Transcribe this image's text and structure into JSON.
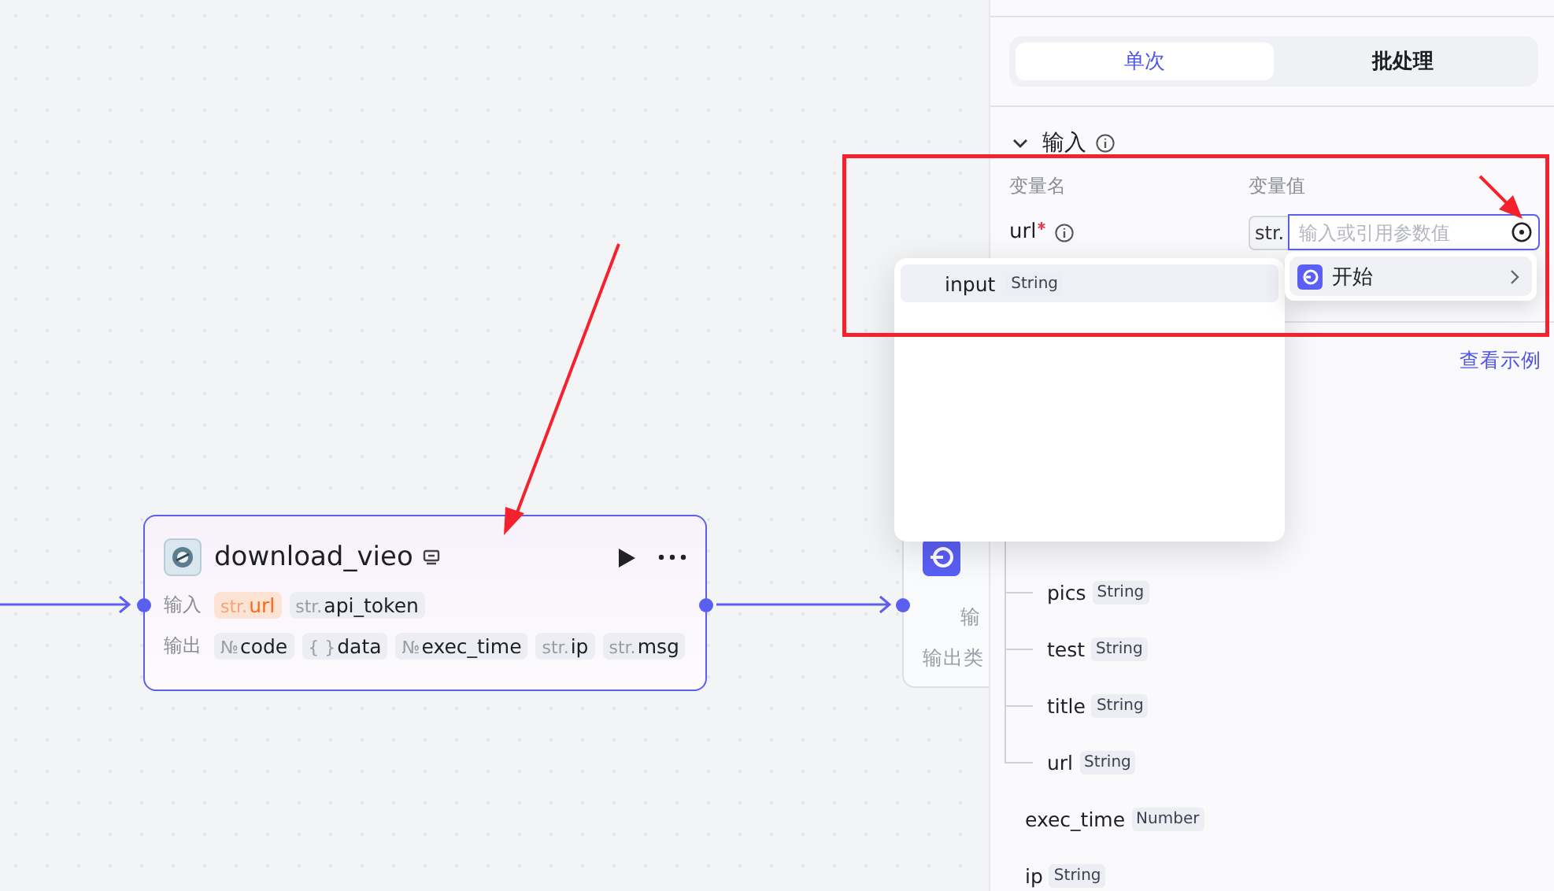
{
  "canvas": {
    "nodes": [
      {
        "title": "download_vieo",
        "selected": true,
        "inputs_label": "输入",
        "outputs_label": "输出",
        "inputs": [
          {
            "type": "str.",
            "name": "url",
            "highlighted": true
          },
          {
            "type": "str.",
            "name": "api_token",
            "highlighted": false
          }
        ],
        "outputs": [
          {
            "type": "№",
            "name": "code"
          },
          {
            "type": "{ }",
            "name": "data"
          },
          {
            "type": "№",
            "name": "exec_time"
          },
          {
            "type": "str.",
            "name": "ip"
          },
          {
            "type": "str.",
            "name": "msg"
          }
        ]
      }
    ],
    "partial_node": {
      "lines": [
        "输",
        "输出类"
      ]
    }
  },
  "panel": {
    "tabs": [
      {
        "label": "单次",
        "selected": true
      },
      {
        "label": "批处理",
        "selected": false
      }
    ],
    "input_section": {
      "title": "输入",
      "expanded": true,
      "columns": [
        "变量名",
        "变量值"
      ],
      "rows": [
        {
          "name": "url",
          "required": true,
          "type": "str.",
          "placeholder": "输入或引用参数值"
        }
      ]
    },
    "example_link": "查看示例",
    "output_tree": [
      {
        "children": [
          {
            "name": "pics",
            "type": "String"
          },
          {
            "name": "test",
            "type": "String"
          },
          {
            "name": "title",
            "type": "String"
          },
          {
            "name": "url",
            "type": "String"
          }
        ]
      },
      {
        "name": "exec_time",
        "type": "Number"
      },
      {
        "name": "ip",
        "type": "String"
      }
    ]
  },
  "popups": {
    "variables": [
      {
        "name": "input",
        "type": "String",
        "selected": true
      }
    ],
    "sources": [
      {
        "label": "开始"
      }
    ]
  }
}
